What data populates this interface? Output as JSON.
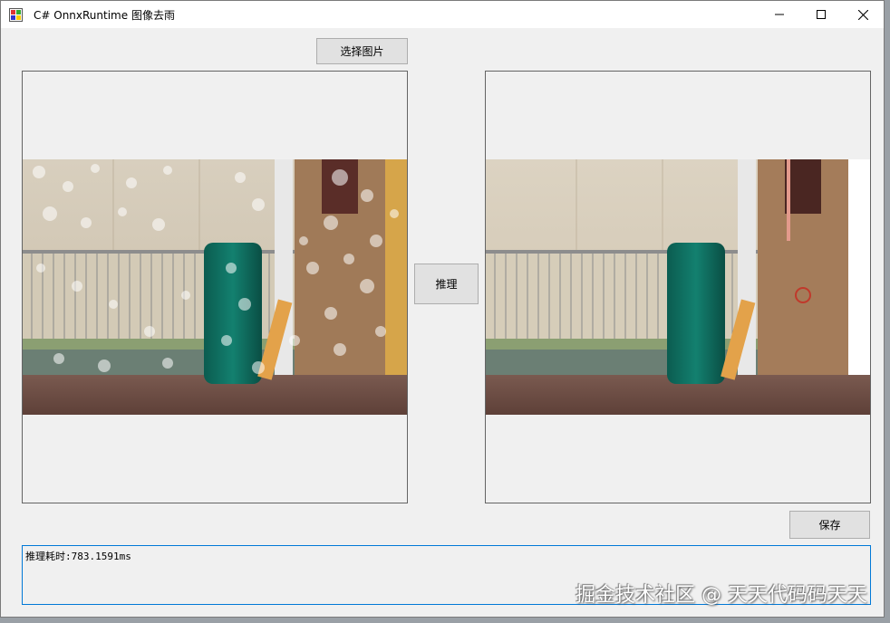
{
  "window": {
    "title": "C# OnnxRuntime 图像去雨",
    "controls": {
      "minimize": "minimize-icon",
      "maximize": "maximize-icon",
      "close": "close-icon"
    }
  },
  "buttons": {
    "select_image": "选择图片",
    "infer": "推理",
    "save": "保存"
  },
  "output": {
    "text": "推理耗时:783.1591ms"
  },
  "watermark": "掘金技术社区 @ 天天代码码天天",
  "images": {
    "left": "rainy-scene-image",
    "right": "derained-scene-image"
  },
  "colors": {
    "window_bg": "#f0f0f0",
    "button_bg": "#e1e1e1",
    "focus_border": "#0078d7",
    "bin_green": "#0e6b5e",
    "pillar_brown": "#a07a58"
  }
}
